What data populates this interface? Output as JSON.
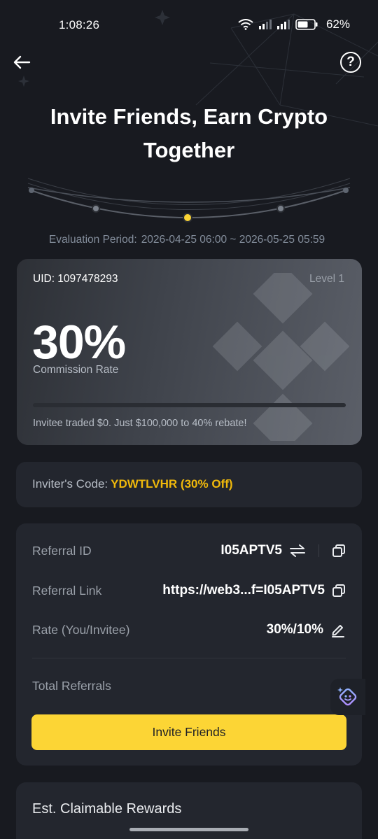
{
  "status_bar": {
    "time": "1:08:26",
    "battery": "62%"
  },
  "header": {
    "title": "Invite Friends, Earn Crypto Together"
  },
  "evaluation": {
    "label": "Evaluation Period:",
    "range": "2026-04-25 06:00 ~ 2026-05-25 05:59"
  },
  "commission": {
    "uid": "UID: 1097478293",
    "level": "Level 1",
    "rate": "30%",
    "rate_label": "Commission Rate",
    "progress_fraction": 0.0,
    "note": "Invitee traded $0. Just $100,000 to 40% rebate!"
  },
  "inviter": {
    "label": "Inviter's Code:",
    "code": "YDWTLVHR (30% Off)"
  },
  "referral": {
    "id_label": "Referral ID",
    "id_value": "I05APTV5",
    "link_label": "Referral Link",
    "link_value": "https://web3...f=I05APTV5",
    "rate_label": "Rate (You/Invitee)",
    "rate_value": "30%/10%",
    "total_label": "Total Referrals",
    "invite_button": "Invite Friends"
  },
  "rewards": {
    "title": "Est. Claimable Rewards"
  },
  "colors": {
    "background": "#181a20",
    "card": "#23262e",
    "accent": "#fcd535",
    "code_accent": "#f0b90b"
  },
  "icons": [
    "back-arrow-icon",
    "help-icon",
    "swap-icon",
    "copy-icon",
    "edit-icon",
    "assistant-icon",
    "wifi-icon",
    "signal-icon",
    "battery-icon"
  ]
}
